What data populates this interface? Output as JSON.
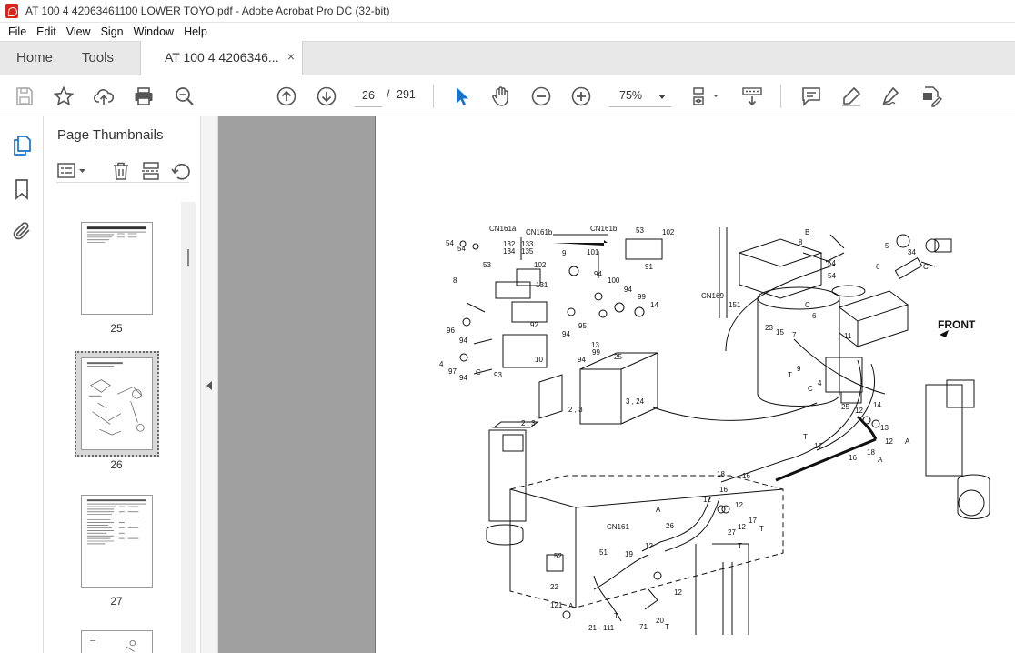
{
  "window": {
    "title": "AT 100 4 42063461100 LOWER TOYO.pdf - Adobe Acrobat Pro DC (32-bit)"
  },
  "menu": [
    "File",
    "Edit",
    "View",
    "Sign",
    "Window",
    "Help"
  ],
  "tabs": {
    "home": "Home",
    "tools": "Tools",
    "document": "AT 100 4 4206346...",
    "close_glyph": "×"
  },
  "toolbar": {
    "current_page": "26",
    "page_separator": "/",
    "total_pages": "291",
    "zoom": "75%"
  },
  "thumbnails": {
    "title": "Page Thumbnails",
    "close_glyph": "✕",
    "pages": [
      {
        "label": "25"
      },
      {
        "label": "26"
      },
      {
        "label": "27"
      }
    ]
  },
  "diagram_labels": {
    "front": "FRONT",
    "cn161a": "CN161a",
    "cn161b_1": "CN161b",
    "cn161b_2": "CN161b",
    "cn161": "CN161",
    "cn169": "CN169",
    "p132_133": "132 , 133",
    "p134_135": "134 , 135"
  },
  "colors": {
    "accent_blue": "#1a73c8",
    "acrobat_red": "#d7261e",
    "doc_background": "#a0a0a0"
  }
}
